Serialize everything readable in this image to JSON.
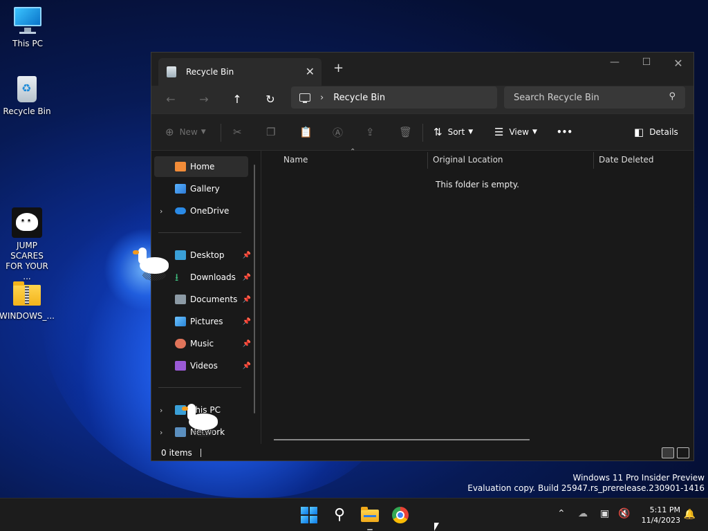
{
  "desktop": {
    "icons": [
      {
        "label": "This PC"
      },
      {
        "label": "Recycle Bin"
      },
      {
        "label": "JUMP SCARES FOR YOUR ..."
      },
      {
        "label": "WINDOWS_..."
      }
    ]
  },
  "window": {
    "tab_title": "Recycle Bin",
    "new_tab": "+",
    "close_tab": "✕",
    "address": {
      "crumb": "Recycle Bin"
    },
    "search": {
      "placeholder": "Search Recycle Bin"
    },
    "toolbar": {
      "new_label": "New",
      "sort_label": "Sort",
      "view_label": "View",
      "more_label": "•••",
      "details_label": "Details"
    },
    "sidebar": {
      "items": [
        {
          "label": "Home"
        },
        {
          "label": "Gallery"
        },
        {
          "label": "OneDrive"
        },
        {
          "label": "Desktop"
        },
        {
          "label": "Downloads"
        },
        {
          "label": "Documents"
        },
        {
          "label": "Pictures"
        },
        {
          "label": "Music"
        },
        {
          "label": "Videos"
        },
        {
          "label": "This PC"
        },
        {
          "label": "Network"
        }
      ]
    },
    "columns": [
      "Name",
      "Original Location",
      "Date Deleted"
    ],
    "empty_message": "This folder is empty.",
    "status": "0 items"
  },
  "watermark": {
    "line1": "Windows 11 Pro Insider Preview",
    "line2": "Evaluation copy. Build 25947.rs_prerelease.230901-1416"
  },
  "taskbar": {
    "time": "5:11 PM",
    "date": "11/4/2023"
  },
  "colors": {
    "accent": "#4cc2ff",
    "window_bg": "#191919"
  }
}
